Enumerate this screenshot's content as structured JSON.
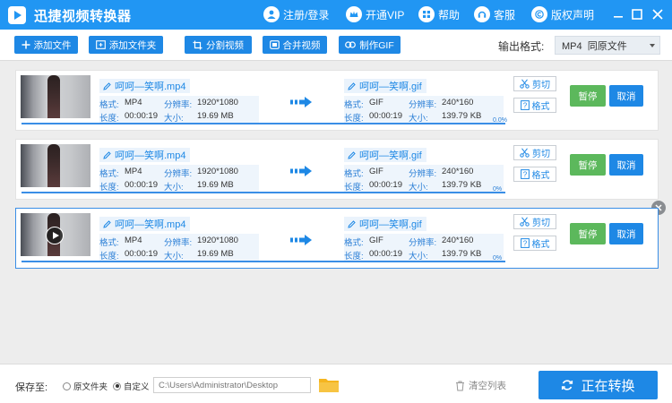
{
  "app": {
    "title": "迅捷视频转换器",
    "menu": [
      {
        "label": "注册/登录",
        "icon": "user-icon"
      },
      {
        "label": "开通VIP",
        "icon": "crown-icon"
      },
      {
        "label": "帮助",
        "icon": "grid-icon"
      },
      {
        "label": "客服",
        "icon": "headset-icon"
      },
      {
        "label": "版权声明",
        "icon": "copyright-icon"
      }
    ]
  },
  "toolbar": {
    "add_file": "添加文件",
    "add_folder": "添加文件夹",
    "split_video": "分割视频",
    "merge_video": "合并视频",
    "make_gif": "制作GIF",
    "format_label": "输出格式:",
    "format_value": "MP4  同原文件"
  },
  "labels": {
    "format": "格式:",
    "resolution": "分辨率:",
    "duration": "长度:",
    "size": "大小:",
    "cut": "剪切",
    "fmt": "格式",
    "pause": "暂停",
    "cancel": "取消"
  },
  "rows": [
    {
      "source": {
        "name": "呵呵—笑啊.mp4",
        "format": "MP4",
        "resolution": "1920*1080",
        "duration": "00:00:19",
        "size": "19.69 MB"
      },
      "output": {
        "name": "呵呵—笑啊.gif",
        "format": "GIF",
        "resolution": "240*160",
        "duration": "00:00:19",
        "size": "139.79 KB"
      },
      "progress": "0.0%"
    },
    {
      "source": {
        "name": "呵呵—笑啊.mp4",
        "format": "MP4",
        "resolution": "1920*1080",
        "duration": "00:00:19",
        "size": "19.69 MB"
      },
      "output": {
        "name": "呵呵—笑啊.gif",
        "format": "GIF",
        "resolution": "240*160",
        "duration": "00:00:19",
        "size": "139.79 KB"
      },
      "progress": "0%"
    },
    {
      "source": {
        "name": "呵呵—笑啊.mp4",
        "format": "MP4",
        "resolution": "1920*1080",
        "duration": "00:00:19",
        "size": "19.69 MB"
      },
      "output": {
        "name": "呵呵—笑啊.gif",
        "format": "GIF",
        "resolution": "240*160",
        "duration": "00:00:19",
        "size": "139.79 KB"
      },
      "progress": "0%"
    }
  ],
  "footer": {
    "save_label": "保存至:",
    "option_source": "原文件夹",
    "option_custom": "自定义",
    "path": "C:\\Users\\Administrator\\Desktop",
    "clear_list": "清空列表",
    "convert": "正在转换"
  },
  "colors": {
    "brand": "#2196f3",
    "button": "#1e88e5",
    "pause": "#5cb85c",
    "folder": "#f5b51f"
  }
}
